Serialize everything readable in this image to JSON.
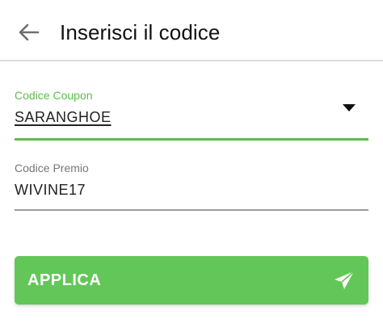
{
  "header": {
    "back_icon": "arrow-left-icon",
    "title": "Inserisci il codice"
  },
  "form": {
    "coupon": {
      "label": "Codice Coupon",
      "value": "SARANGHOE",
      "dropdown_icon": "triangle-down-icon"
    },
    "premio": {
      "label": "Codice Premio",
      "value": "WIVINE17"
    }
  },
  "apply_button": {
    "label": "APPLICA",
    "icon": "send-icon"
  },
  "colors": {
    "accent": "#5cbf4a",
    "button": "#63c659",
    "text": "#111111"
  }
}
